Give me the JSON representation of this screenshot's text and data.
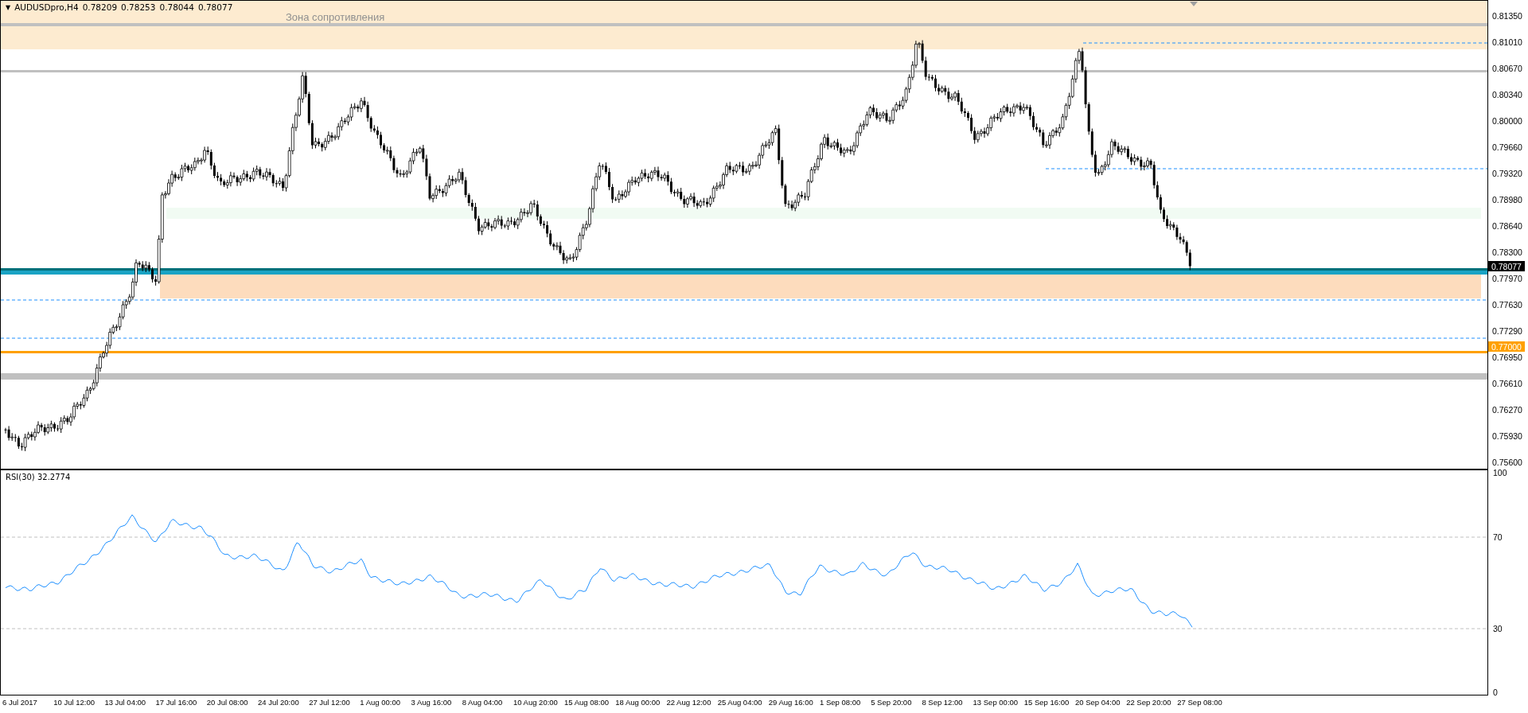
{
  "chart": {
    "collapse_glyph": "▼",
    "symbol": "AUDUSDpro,H4",
    "ohlc": [
      "0.78209",
      "0.78253",
      "0.78044",
      "0.78077"
    ],
    "zone_label": "Зона сопротивления"
  },
  "price_axis": {
    "labels": [
      "0.81350",
      "0.81010",
      "0.80670",
      "0.80340",
      "0.80000",
      "0.79660",
      "0.79320",
      "0.78980",
      "0.78640",
      "0.78300",
      "0.77970",
      "0.77630",
      "0.77290",
      "0.76950",
      "0.76610",
      "0.76270",
      "0.75930",
      "0.75600"
    ],
    "markers": [
      {
        "value": "0.78077",
        "kind": "current"
      },
      {
        "value": "0.77000",
        "kind": "level"
      }
    ]
  },
  "indicator": {
    "label": "RSI(30) 32.2774",
    "ticks": [
      "100",
      "70",
      "30",
      "0"
    ]
  },
  "time_axis": {
    "labels": [
      "6 Jul 2017",
      "10 Jul 12:00",
      "13 Jul 04:00",
      "17 Jul 16:00",
      "20 Jul 08:00",
      "24 Jul 20:00",
      "27 Jul 12:00",
      "1 Aug 00:00",
      "3 Aug 16:00",
      "8 Aug 04:00",
      "10 Aug 20:00",
      "15 Aug 08:00",
      "18 Aug 00:00",
      "22 Aug 12:00",
      "25 Aug 04:00",
      "29 Aug 16:00",
      "1 Sep 08:00",
      "5 Sep 20:00",
      "8 Sep 12:00",
      "13 Sep 00:00",
      "15 Sep 16:00",
      "20 Sep 04:00",
      "22 Sep 20:00",
      "27 Sep 08:00"
    ]
  }
}
